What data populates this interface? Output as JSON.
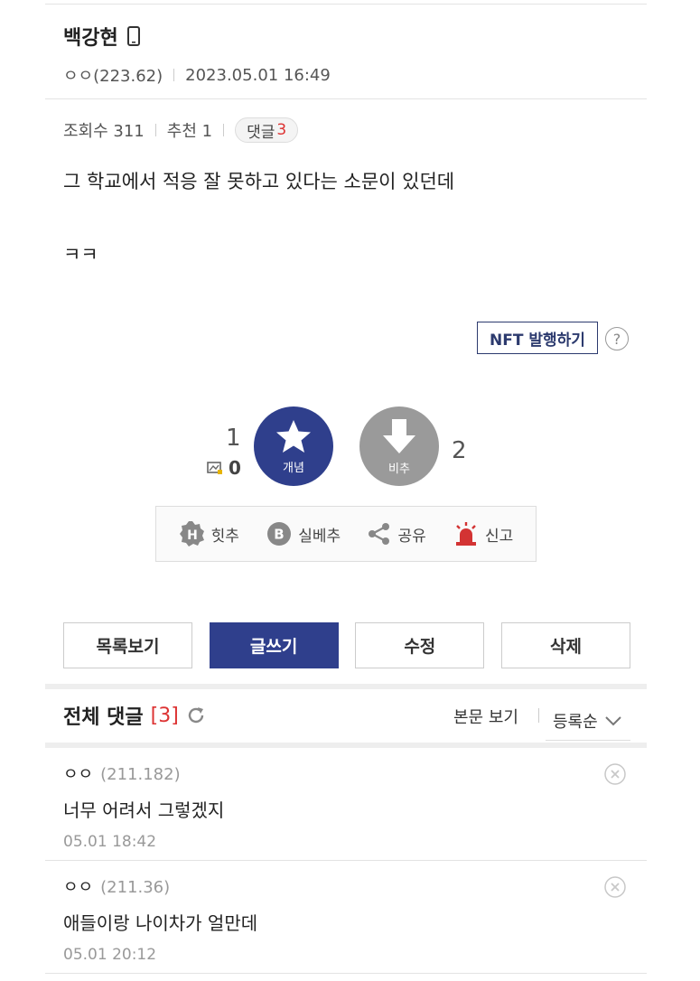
{
  "post": {
    "author": "백강현",
    "writer_nick": "ㅇㅇ(223.62)",
    "date": "2023.05.01 16:49",
    "views": "조회수 311",
    "recommend": "추천 1",
    "comment_label": "댓글",
    "comment_count": "3",
    "body_line1": "그 학교에서 적응 잘 못하고 있다는 소문이 있던데",
    "body_line2": "ㅋㅋ"
  },
  "nft": {
    "label": "NFT 발행하기",
    "help": "?"
  },
  "vote": {
    "up_count": "1",
    "fixed_count": "0",
    "up_label": "개념",
    "down_label": "비추",
    "down_count": "2"
  },
  "actions": {
    "hit": "힛추",
    "best": "실베추",
    "share": "공유",
    "report": "신고"
  },
  "buttons": {
    "list": "목록보기",
    "write": "글쓰기",
    "edit": "수정",
    "delete": "삭제"
  },
  "comments_section": {
    "title": "전체 댓글",
    "count": "[3]",
    "view_body": "본문 보기",
    "sort": "등록순"
  },
  "comments": [
    {
      "nick": "ㅇㅇ",
      "ip": "(211.182)",
      "text": "너무 어려서 그렇겠지",
      "date": "05.01 18:42"
    },
    {
      "nick": "ㅇㅇ",
      "ip": "(211.36)",
      "text": "애들이랑 나이차가 얼만데",
      "date": "05.01 20:12"
    }
  ],
  "colors": {
    "primary": "#2f3f8c",
    "accent_red": "#d33333",
    "disabled": "#9a9a9a"
  }
}
